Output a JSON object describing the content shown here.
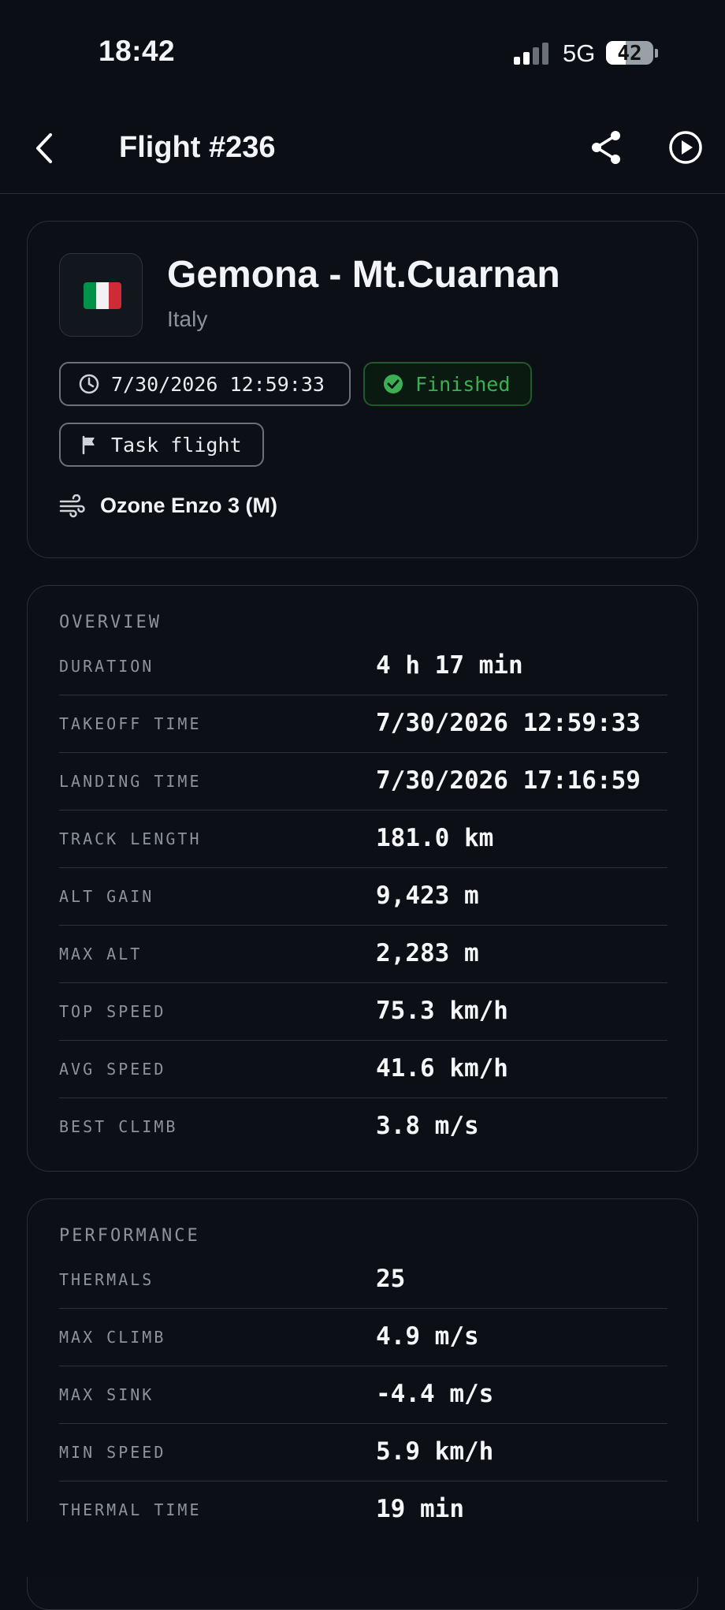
{
  "status_bar": {
    "time": "18:42",
    "network": "5G",
    "battery": "42",
    "battery_level": 0.42
  },
  "header": {
    "title": "Flight #236",
    "back_icon": "chevron-left-icon",
    "share_icon": "share-icon",
    "play_icon": "play-circle-icon"
  },
  "site": {
    "flag": "italy-flag",
    "name": "Gemona - Mt.Cuarnan",
    "country": "Italy",
    "date_chip": "7/30/2026 12:59:33",
    "status_chip": "Finished",
    "task_chip": "Task flight",
    "glider": "Ozone Enzo 3 (M)",
    "colors": {
      "status": "#3cae54",
      "flag_green": "#009246",
      "flag_white": "#f1f2f1",
      "flag_red": "#ce2b37"
    }
  },
  "overview": {
    "title": "OVERVIEW",
    "rows": [
      {
        "label": "DURATION",
        "value": "4 h 17 min"
      },
      {
        "label": "TAKEOFF TIME",
        "value": "7/30/2026 12:59:33"
      },
      {
        "label": "LANDING TIME",
        "value": "7/30/2026 17:16:59"
      },
      {
        "label": "TRACK LENGTH",
        "value": "181.0 km"
      },
      {
        "label": "ALT GAIN",
        "value": "9,423 m"
      },
      {
        "label": "MAX ALT",
        "value": "2,283 m"
      },
      {
        "label": "TOP SPEED",
        "value": "75.3 km/h"
      },
      {
        "label": "AVG SPEED",
        "value": "41.6 km/h"
      },
      {
        "label": "BEST CLIMB",
        "value": "3.8 m/s"
      }
    ]
  },
  "performance": {
    "title": "PERFORMANCE",
    "rows": [
      {
        "label": "THERMALS",
        "value": "25"
      },
      {
        "label": "MAX CLIMB",
        "value": "4.9 m/s"
      },
      {
        "label": "MAX SINK",
        "value": "-4.4 m/s"
      },
      {
        "label": "MIN SPEED",
        "value": "5.9 km/h"
      },
      {
        "label": "THERMAL TIME",
        "value": "19 min"
      }
    ]
  }
}
